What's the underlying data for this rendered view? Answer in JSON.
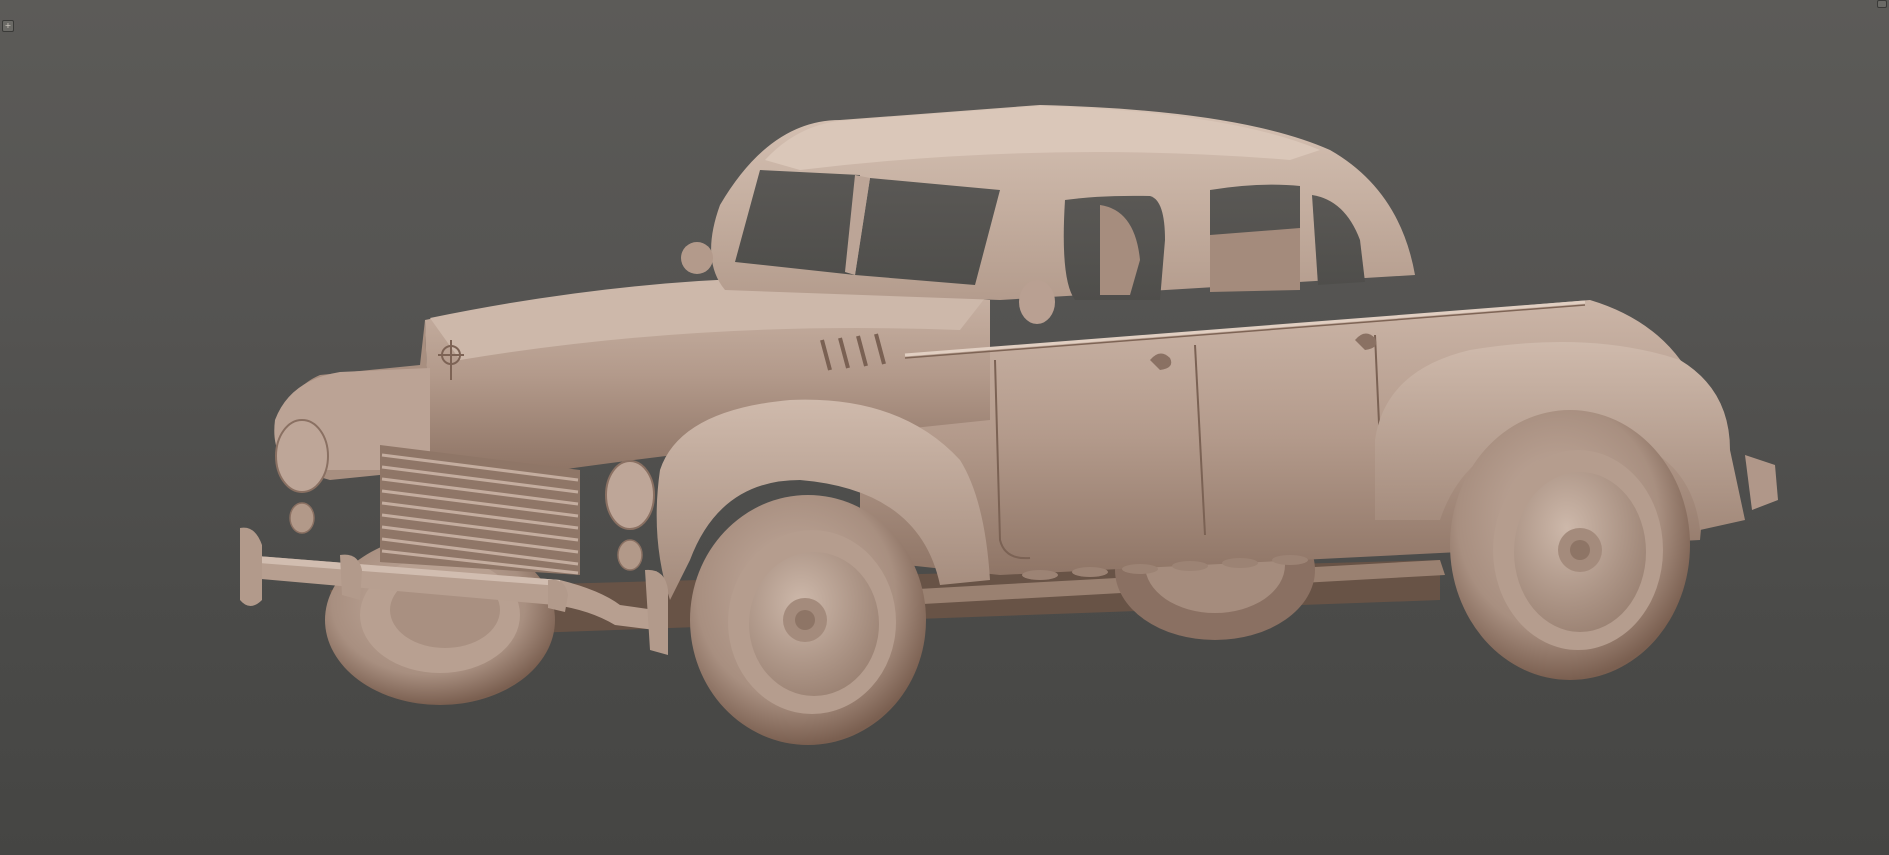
{
  "viewport": {
    "background_top": "#5c5b58",
    "background_bottom": "#454543"
  },
  "model": {
    "material_color": "#b39a8b",
    "shadow_color": "#6e5546",
    "highlight_color": "#d4bfb1"
  },
  "controls": {
    "corner_top_left_icon": "plus-icon",
    "corner_top_right_icon": "maximize-icon"
  }
}
